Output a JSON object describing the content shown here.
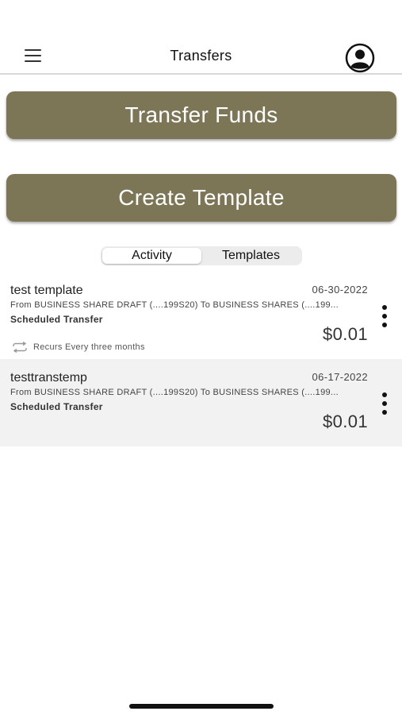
{
  "header": {
    "title": "Transfers"
  },
  "actions": {
    "transfer_funds": "Transfer Funds",
    "create_template": "Create Template"
  },
  "tabs": [
    {
      "label": "Activity",
      "active": true
    },
    {
      "label": "Templates",
      "active": false
    }
  ],
  "transfers": [
    {
      "name": "test template",
      "date": "06-30-2022",
      "description": "From BUSINESS SHARE DRAFT (....199S20) To BUSINESS SHARES (....199...",
      "type": "Scheduled Transfer",
      "amount": "$0.01",
      "recurrence": "Recurs Every three months"
    },
    {
      "name": "testtranstemp",
      "date": "06-17-2022",
      "description": "From BUSINESS SHARE DRAFT (....199S20) To BUSINESS SHARES (....199...",
      "type": "Scheduled Transfer",
      "amount": "$0.01"
    }
  ],
  "colors": {
    "accent": "#7c7657",
    "alt_row": "#f2f2f2"
  },
  "icons": {
    "menu": "hamburger-menu-icon",
    "profile": "user-profile-icon",
    "more": "vertical-ellipsis-icon",
    "recur": "repeat-icon"
  }
}
